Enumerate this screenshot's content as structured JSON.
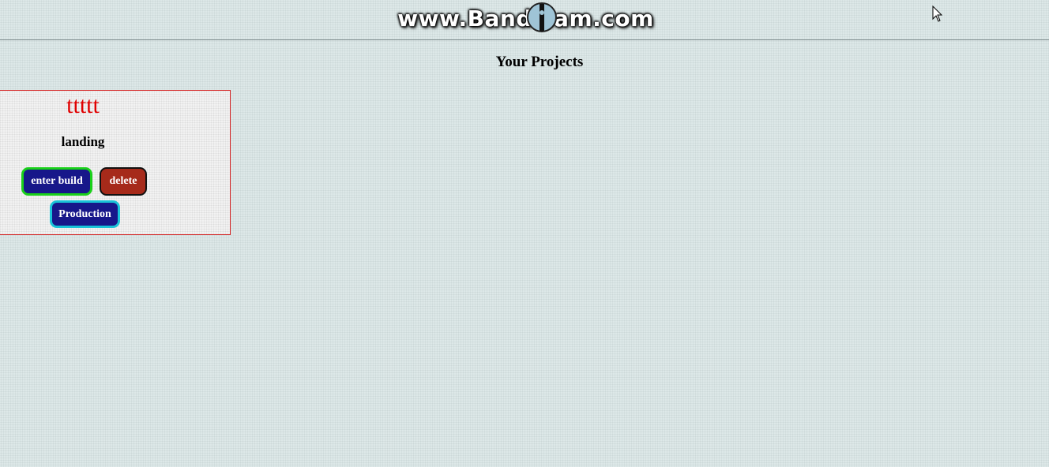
{
  "watermark": {
    "text": "www.Bandicam.com"
  },
  "page": {
    "title": "Your Projects"
  },
  "projects": [
    {
      "name": "ttttt",
      "type": "landing",
      "buttons": {
        "enter_build": "enter build",
        "delete": "delete",
        "production": "Production"
      }
    }
  ],
  "colors": {
    "background": "#dde8e8",
    "card_border": "#d42020",
    "project_name": "#e00000",
    "button_primary": "#17178a",
    "button_danger": "#a62a1a",
    "enter_border": "#1ad01a",
    "production_border": "#19c3d8"
  },
  "icons": {
    "watermark_logo": "bandicam-logo-icon",
    "cursor": "mouse-pointer-icon"
  }
}
